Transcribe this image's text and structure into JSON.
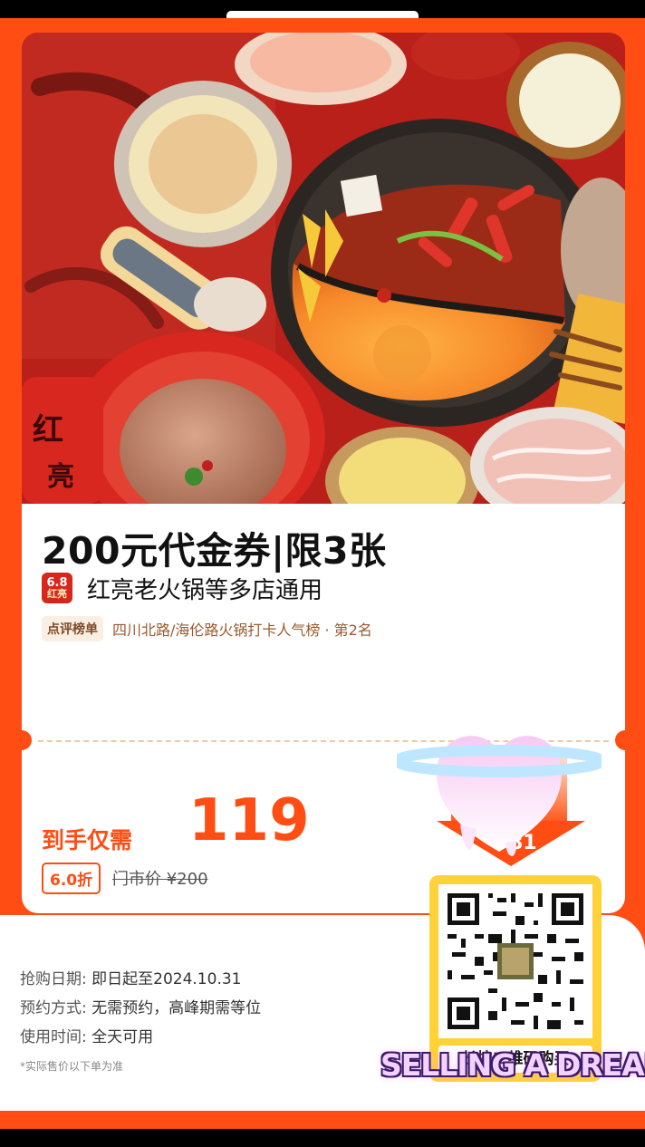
{
  "coupon": {
    "title": "200元代金券|限3张",
    "store_logo_top": "6.8",
    "store_logo_bottom": "红亮",
    "store_name": "红亮老火锅等多店通用",
    "rank_tag": "点评榜单",
    "rank_text": "四川北路/海伦路火锅打卡人气榜 · 第2名",
    "price_label": "到手仅需",
    "price": "119",
    "discount": "6.0折",
    "original_price": "门市价 ¥200"
  },
  "arrow": {
    "number": "81"
  },
  "info": {
    "purchase_date_label": "抢购日期:",
    "purchase_date_value": "即日起至2024.10.31",
    "reservation_label": "预约方式:",
    "reservation_value": "无需预约，高峰期需等位",
    "usage_label": "使用时间:",
    "usage_value": "全天可用",
    "note": "*实际售价以下单为准"
  },
  "qr": {
    "caption": "长按二维码购买"
  },
  "watermark": "SELLING A DREAM",
  "colors": {
    "brand_orange": "#ff4d13",
    "qr_frame": "#ffd23a"
  }
}
